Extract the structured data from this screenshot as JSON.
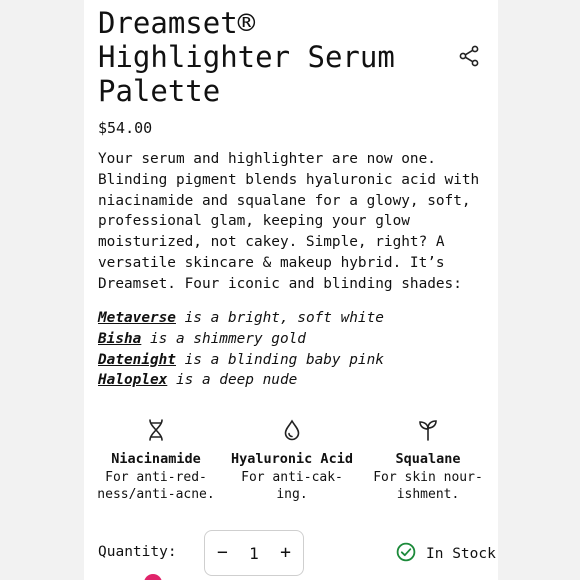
{
  "product": {
    "title": "Dreamset® Highlighter Serum Palette",
    "price": "$54.00",
    "description": "Your serum and highlighter are now one. Blinding pigment blends hyaluronic acid with niacinamide and squalane for a glowy, soft, professional glam, keeping your glow moisturized, not cakey. Simple, right? A versatile skincare & makeup hybrid. It’s Dreamset. Four iconic and blinding shades:"
  },
  "shades": [
    {
      "name": "Metaverse",
      "text": " is a bright, soft white"
    },
    {
      "name": "Bisha",
      "text": " is a shimmery gold"
    },
    {
      "name": "Datenight",
      "text": " is a blinding baby pink"
    },
    {
      "name": "Haloplex",
      "text": " is a deep nude"
    }
  ],
  "features": [
    {
      "icon": "dna-icon",
      "name": "Niacinamide",
      "desc": "For anti-red-ness/anti-acne."
    },
    {
      "icon": "droplet-icon",
      "name": "Hyaluronic Acid",
      "desc": "For anti-cak-ing."
    },
    {
      "icon": "sprout-icon",
      "name": "Squalane",
      "desc": "For skin nour-ishment."
    }
  ],
  "purchase": {
    "quantity_label": "Quantity:",
    "quantity_value": "1",
    "minus": "−",
    "plus": "+",
    "stock_label": "In Stock"
  },
  "colors": {
    "stock_green": "#1c8a3a",
    "peek_pink": "#e0246a"
  }
}
